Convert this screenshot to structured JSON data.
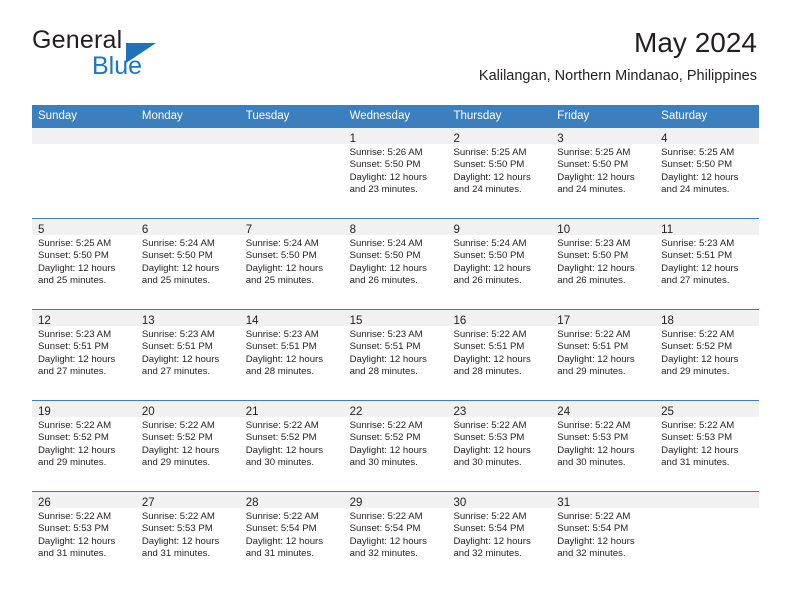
{
  "brand": {
    "name_top": "General",
    "name_bottom": "Blue",
    "triangle_color": "#1f72b8",
    "blue_color": "#1b76c4"
  },
  "header": {
    "title": "May 2024",
    "subtitle": "Kalilangan, Northern Mindanao, Philippines"
  },
  "theme": {
    "header_blue": "#3b7fbe",
    "day_number_band": "#f1f1f1",
    "text": "#231f20"
  },
  "calendar": {
    "weekdays": [
      "Sunday",
      "Monday",
      "Tuesday",
      "Wednesday",
      "Thursday",
      "Friday",
      "Saturday"
    ],
    "weeks": [
      [
        {
          "day": "",
          "lines": []
        },
        {
          "day": "",
          "lines": []
        },
        {
          "day": "",
          "lines": []
        },
        {
          "day": "1",
          "lines": [
            "Sunrise: 5:26 AM",
            "Sunset: 5:50 PM",
            "Daylight: 12 hours",
            "and 23 minutes."
          ]
        },
        {
          "day": "2",
          "lines": [
            "Sunrise: 5:25 AM",
            "Sunset: 5:50 PM",
            "Daylight: 12 hours",
            "and 24 minutes."
          ]
        },
        {
          "day": "3",
          "lines": [
            "Sunrise: 5:25 AM",
            "Sunset: 5:50 PM",
            "Daylight: 12 hours",
            "and 24 minutes."
          ]
        },
        {
          "day": "4",
          "lines": [
            "Sunrise: 5:25 AM",
            "Sunset: 5:50 PM",
            "Daylight: 12 hours",
            "and 24 minutes."
          ]
        }
      ],
      [
        {
          "day": "5",
          "lines": [
            "Sunrise: 5:25 AM",
            "Sunset: 5:50 PM",
            "Daylight: 12 hours",
            "and 25 minutes."
          ]
        },
        {
          "day": "6",
          "lines": [
            "Sunrise: 5:24 AM",
            "Sunset: 5:50 PM",
            "Daylight: 12 hours",
            "and 25 minutes."
          ]
        },
        {
          "day": "7",
          "lines": [
            "Sunrise: 5:24 AM",
            "Sunset: 5:50 PM",
            "Daylight: 12 hours",
            "and 25 minutes."
          ]
        },
        {
          "day": "8",
          "lines": [
            "Sunrise: 5:24 AM",
            "Sunset: 5:50 PM",
            "Daylight: 12 hours",
            "and 26 minutes."
          ]
        },
        {
          "day": "9",
          "lines": [
            "Sunrise: 5:24 AM",
            "Sunset: 5:50 PM",
            "Daylight: 12 hours",
            "and 26 minutes."
          ]
        },
        {
          "day": "10",
          "lines": [
            "Sunrise: 5:23 AM",
            "Sunset: 5:50 PM",
            "Daylight: 12 hours",
            "and 26 minutes."
          ]
        },
        {
          "day": "11",
          "lines": [
            "Sunrise: 5:23 AM",
            "Sunset: 5:51 PM",
            "Daylight: 12 hours",
            "and 27 minutes."
          ]
        }
      ],
      [
        {
          "day": "12",
          "lines": [
            "Sunrise: 5:23 AM",
            "Sunset: 5:51 PM",
            "Daylight: 12 hours",
            "and 27 minutes."
          ]
        },
        {
          "day": "13",
          "lines": [
            "Sunrise: 5:23 AM",
            "Sunset: 5:51 PM",
            "Daylight: 12 hours",
            "and 27 minutes."
          ]
        },
        {
          "day": "14",
          "lines": [
            "Sunrise: 5:23 AM",
            "Sunset: 5:51 PM",
            "Daylight: 12 hours",
            "and 28 minutes."
          ]
        },
        {
          "day": "15",
          "lines": [
            "Sunrise: 5:23 AM",
            "Sunset: 5:51 PM",
            "Daylight: 12 hours",
            "and 28 minutes."
          ]
        },
        {
          "day": "16",
          "lines": [
            "Sunrise: 5:22 AM",
            "Sunset: 5:51 PM",
            "Daylight: 12 hours",
            "and 28 minutes."
          ]
        },
        {
          "day": "17",
          "lines": [
            "Sunrise: 5:22 AM",
            "Sunset: 5:51 PM",
            "Daylight: 12 hours",
            "and 29 minutes."
          ]
        },
        {
          "day": "18",
          "lines": [
            "Sunrise: 5:22 AM",
            "Sunset: 5:52 PM",
            "Daylight: 12 hours",
            "and 29 minutes."
          ]
        }
      ],
      [
        {
          "day": "19",
          "lines": [
            "Sunrise: 5:22 AM",
            "Sunset: 5:52 PM",
            "Daylight: 12 hours",
            "and 29 minutes."
          ]
        },
        {
          "day": "20",
          "lines": [
            "Sunrise: 5:22 AM",
            "Sunset: 5:52 PM",
            "Daylight: 12 hours",
            "and 29 minutes."
          ]
        },
        {
          "day": "21",
          "lines": [
            "Sunrise: 5:22 AM",
            "Sunset: 5:52 PM",
            "Daylight: 12 hours",
            "and 30 minutes."
          ]
        },
        {
          "day": "22",
          "lines": [
            "Sunrise: 5:22 AM",
            "Sunset: 5:52 PM",
            "Daylight: 12 hours",
            "and 30 minutes."
          ]
        },
        {
          "day": "23",
          "lines": [
            "Sunrise: 5:22 AM",
            "Sunset: 5:53 PM",
            "Daylight: 12 hours",
            "and 30 minutes."
          ]
        },
        {
          "day": "24",
          "lines": [
            "Sunrise: 5:22 AM",
            "Sunset: 5:53 PM",
            "Daylight: 12 hours",
            "and 30 minutes."
          ]
        },
        {
          "day": "25",
          "lines": [
            "Sunrise: 5:22 AM",
            "Sunset: 5:53 PM",
            "Daylight: 12 hours",
            "and 31 minutes."
          ]
        }
      ],
      [
        {
          "day": "26",
          "lines": [
            "Sunrise: 5:22 AM",
            "Sunset: 5:53 PM",
            "Daylight: 12 hours",
            "and 31 minutes."
          ]
        },
        {
          "day": "27",
          "lines": [
            "Sunrise: 5:22 AM",
            "Sunset: 5:53 PM",
            "Daylight: 12 hours",
            "and 31 minutes."
          ]
        },
        {
          "day": "28",
          "lines": [
            "Sunrise: 5:22 AM",
            "Sunset: 5:54 PM",
            "Daylight: 12 hours",
            "and 31 minutes."
          ]
        },
        {
          "day": "29",
          "lines": [
            "Sunrise: 5:22 AM",
            "Sunset: 5:54 PM",
            "Daylight: 12 hours",
            "and 32 minutes."
          ]
        },
        {
          "day": "30",
          "lines": [
            "Sunrise: 5:22 AM",
            "Sunset: 5:54 PM",
            "Daylight: 12 hours",
            "and 32 minutes."
          ]
        },
        {
          "day": "31",
          "lines": [
            "Sunrise: 5:22 AM",
            "Sunset: 5:54 PM",
            "Daylight: 12 hours",
            "and 32 minutes."
          ]
        },
        {
          "day": "",
          "lines": []
        }
      ]
    ]
  }
}
